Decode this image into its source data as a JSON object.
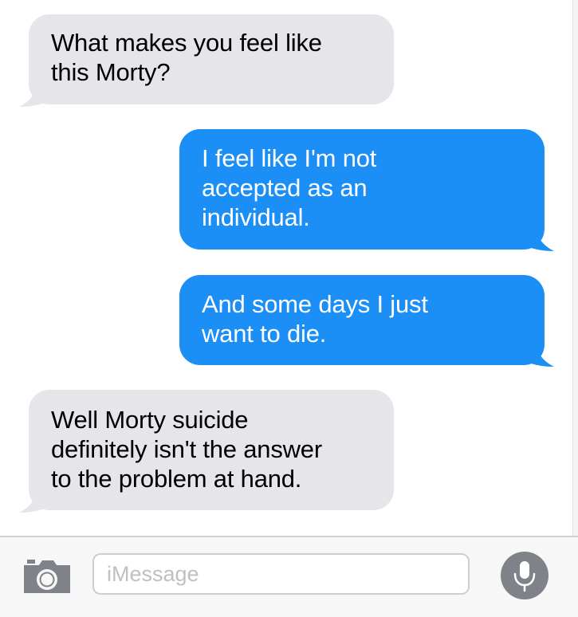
{
  "messages": [
    {
      "side": "incoming",
      "text": "What makes you feel like\nthis Morty?"
    },
    {
      "side": "outgoing",
      "text": "I feel like I'm not\naccepted as an\nindividual."
    },
    {
      "side": "outgoing",
      "text": "And some days I just\nwant to die."
    },
    {
      "side": "incoming",
      "text": "Well Morty suicide\ndefinitely isn't the answer\nto the problem at hand."
    }
  ],
  "composer": {
    "placeholder": "iMessage",
    "camera_icon": "camera-icon",
    "mic_icon": "microphone-icon"
  },
  "colors": {
    "incoming_bubble": "#e5e5ea",
    "outgoing_bubble": "#1b8ff5",
    "outgoing_text": "#ffffff",
    "incoming_text": "#000000",
    "placeholder_text": "#bfbfc4",
    "mic_button": "#7f8389",
    "camera_icon": "#7f8389"
  }
}
